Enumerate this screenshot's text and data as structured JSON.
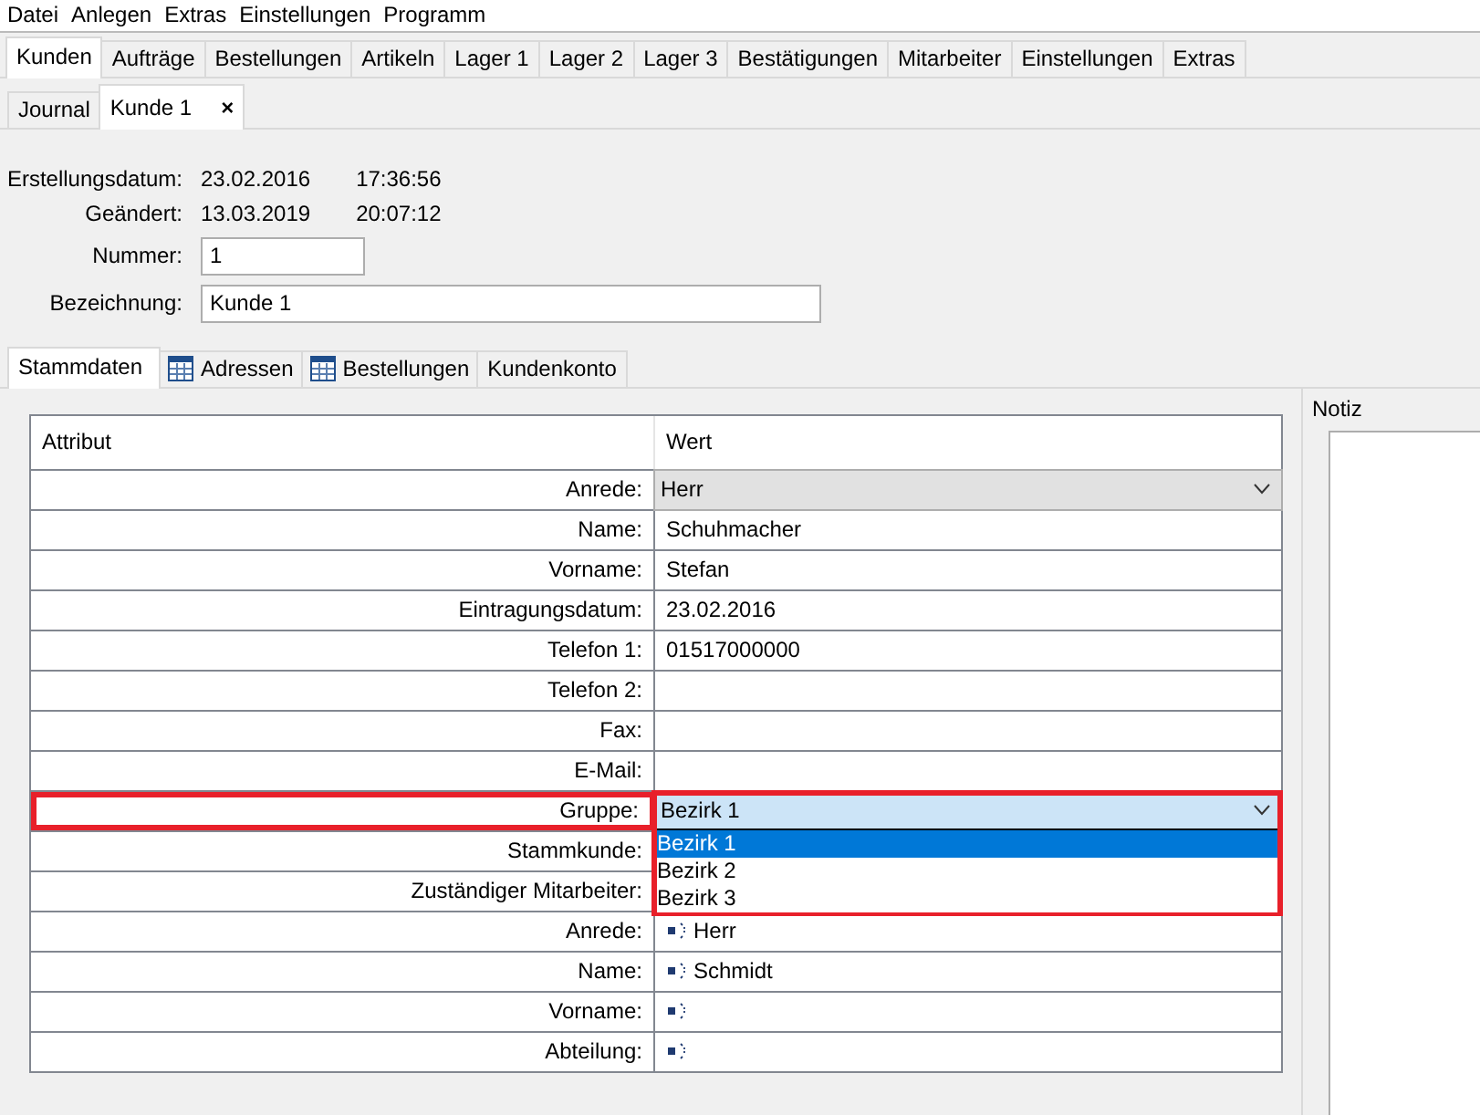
{
  "menu": [
    "Datei",
    "Anlegen",
    "Extras",
    "Einstellungen",
    "Programm"
  ],
  "module_tabs": [
    {
      "label": "Kunden",
      "selected": true
    },
    {
      "label": "Aufträge",
      "selected": false
    },
    {
      "label": "Bestellungen",
      "selected": false
    },
    {
      "label": "Artikeln",
      "selected": false
    },
    {
      "label": "Lager 1",
      "selected": false
    },
    {
      "label": "Lager 2",
      "selected": false
    },
    {
      "label": "Lager 3",
      "selected": false
    },
    {
      "label": "Bestätigungen",
      "selected": false
    },
    {
      "label": "Mitarbeiter",
      "selected": false
    },
    {
      "label": "Einstellungen",
      "selected": false
    },
    {
      "label": "Extras",
      "selected": false
    }
  ],
  "document_tabs": [
    {
      "label": "Journal",
      "selected": false,
      "closable": false
    },
    {
      "label": "Kunde 1",
      "selected": true,
      "closable": true,
      "close": "×"
    }
  ],
  "info": [
    {
      "label": "Erstellungsdatum:",
      "date": "23.02.2016",
      "time": "17:36:56"
    },
    {
      "label": "Geändert:",
      "date": "13.03.2019",
      "time": "20:07:12"
    }
  ],
  "fields": [
    {
      "label": "Nummer:",
      "value": "1"
    },
    {
      "label": "Bezeichnung:",
      "value": "Kunde 1"
    }
  ],
  "detail_tabs": [
    {
      "label": "Stammdaten",
      "selected": true,
      "kind": "plain"
    },
    {
      "label": "Adressen",
      "selected": false,
      "kind": "grid"
    },
    {
      "label": "Bestellungen",
      "selected": false,
      "kind": "grid"
    },
    {
      "label": "Kundenkonto",
      "selected": false,
      "kind": "plain"
    }
  ],
  "table": {
    "columns": [
      "Attribut",
      "Wert"
    ],
    "rows": [
      {
        "label": "Anrede:",
        "value": "Herr",
        "kind": "combo",
        "highlighted": false
      },
      {
        "label": "Name:",
        "value": "Schuhmacher",
        "kind": "text",
        "highlighted": false
      },
      {
        "label": "Vorname:",
        "value": "Stefan",
        "kind": "text",
        "highlighted": false
      },
      {
        "label": "Eintragungsdatum:",
        "value": "23.02.2016",
        "kind": "text",
        "highlighted": false
      },
      {
        "label": "Telefon 1:",
        "value": "01517000000",
        "kind": "text",
        "highlighted": false
      },
      {
        "label": "Telefon 2:",
        "kind": "text",
        "highlighted": false
      },
      {
        "label": "Fax:",
        "kind": "text",
        "highlighted": false
      },
      {
        "label": "E-Mail:",
        "kind": "text",
        "highlighted": false
      },
      {
        "label": "Gruppe:",
        "value": "Bezirk 1",
        "kind": "open-combo",
        "highlighted": true,
        "options": [
          {
            "label": "Bezirk 1",
            "selected": true
          },
          {
            "label": "Bezirk 2",
            "selected": false
          },
          {
            "label": "Bezirk 3",
            "selected": false
          }
        ]
      },
      {
        "label": "Stammkunde:",
        "kind": "text",
        "highlighted": false
      },
      {
        "label": "Zuständiger Mitarbeiter:",
        "kind": "text",
        "highlighted": false
      },
      {
        "label": "Anrede:",
        "value": "Herr",
        "kind": "contact",
        "highlighted": false
      },
      {
        "label": "Name:",
        "value": "Schmidt",
        "kind": "contact",
        "highlighted": false
      },
      {
        "label": "Vorname:",
        "kind": "contact",
        "highlighted": false
      },
      {
        "label": "Abteilung:",
        "kind": "contact",
        "highlighted": false
      }
    ]
  },
  "notes": {
    "title": "Notiz"
  }
}
